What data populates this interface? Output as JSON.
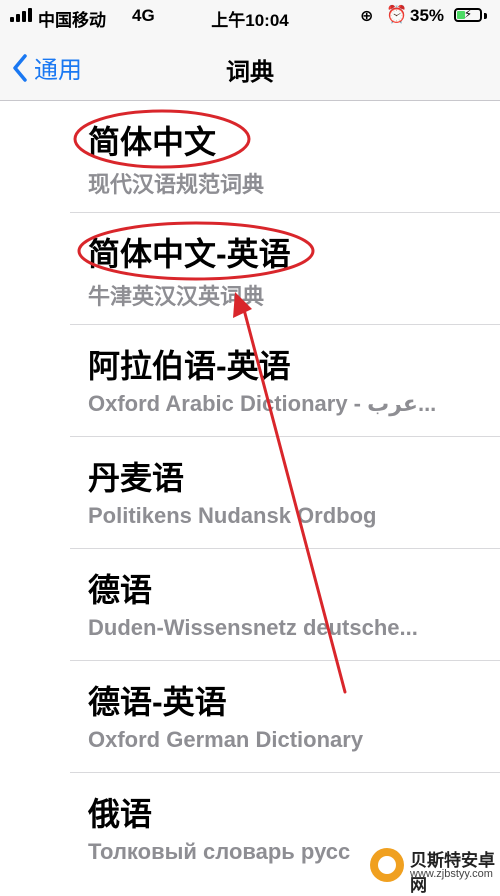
{
  "status_bar": {
    "carrier": "中国移动",
    "network": "4G",
    "time": "上午10:04",
    "battery_percent": "35%",
    "battery_level": 0.35,
    "icons": [
      "signal-icon",
      "rotation-lock-icon",
      "alarm-icon",
      "battery-icon"
    ]
  },
  "nav": {
    "back_label": "通用",
    "title": "词典"
  },
  "dictionaries": [
    {
      "title": "简体中文",
      "subtitle": "现代汉语规范词典"
    },
    {
      "title": "简体中文-英语",
      "subtitle": "牛津英汉汉英词典"
    },
    {
      "title": "阿拉伯语-英语",
      "subtitle": "Oxford Arabic Dictionary - عرب..."
    },
    {
      "title": "丹麦语",
      "subtitle": "Politikens Nudansk Ordbog"
    },
    {
      "title": "德语",
      "subtitle": "Duden-Wissensnetz deutsche..."
    },
    {
      "title": "德语-英语",
      "subtitle": "Oxford German Dictionary"
    },
    {
      "title": "俄语",
      "subtitle": "Толковый словарь русс"
    }
  ],
  "watermark": {
    "name": "贝斯特安卓网",
    "url": "www.zjbstyy.com"
  },
  "colors": {
    "accent": "#1a78f2",
    "annotation": "#d9262b",
    "battery": "#4cd964"
  }
}
